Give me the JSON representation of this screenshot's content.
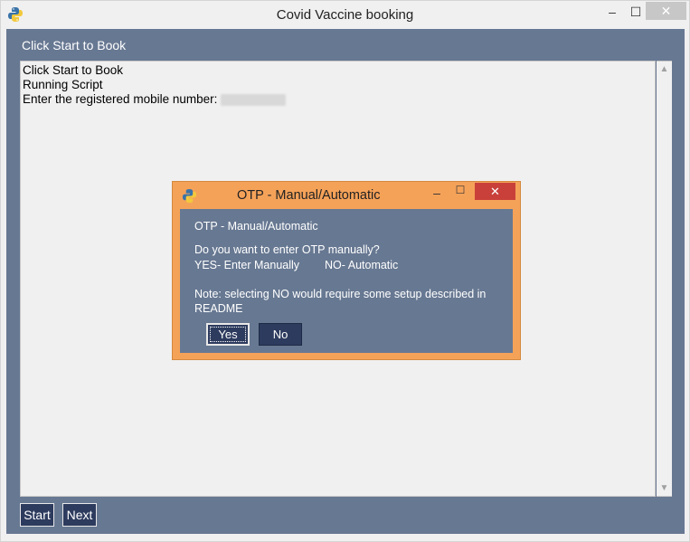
{
  "window": {
    "title": "Covid Vaccine booking",
    "icon": "python-icon",
    "controls": {
      "minimize": "–",
      "maximize": "☐",
      "close": "✕"
    }
  },
  "status_label": "Click Start to Book",
  "output": {
    "lines": [
      "Click Start to Book",
      "Running Script",
      "Enter the registered mobile number:"
    ]
  },
  "buttons": {
    "start": "Start",
    "next": "Next"
  },
  "dialog": {
    "title": "OTP - Manual/Automatic",
    "icon": "python-icon",
    "heading": "OTP - Manual/Automatic",
    "question": "Do you want to enter OTP manually?",
    "yes_option": "YES- Enter Manually",
    "no_option": "NO- Automatic",
    "note_line1": "Note: selecting NO would require some setup described in",
    "note_line2": "README",
    "yes_label": "Yes",
    "no_label": "No",
    "controls": {
      "minimize": "–",
      "maximize": "☐",
      "close": "✕"
    }
  },
  "colors": {
    "client_bg": "#677892",
    "button_bg": "#2d3b5e",
    "dialog_frame": "#f5a259",
    "dialog_close": "#c9403a"
  }
}
